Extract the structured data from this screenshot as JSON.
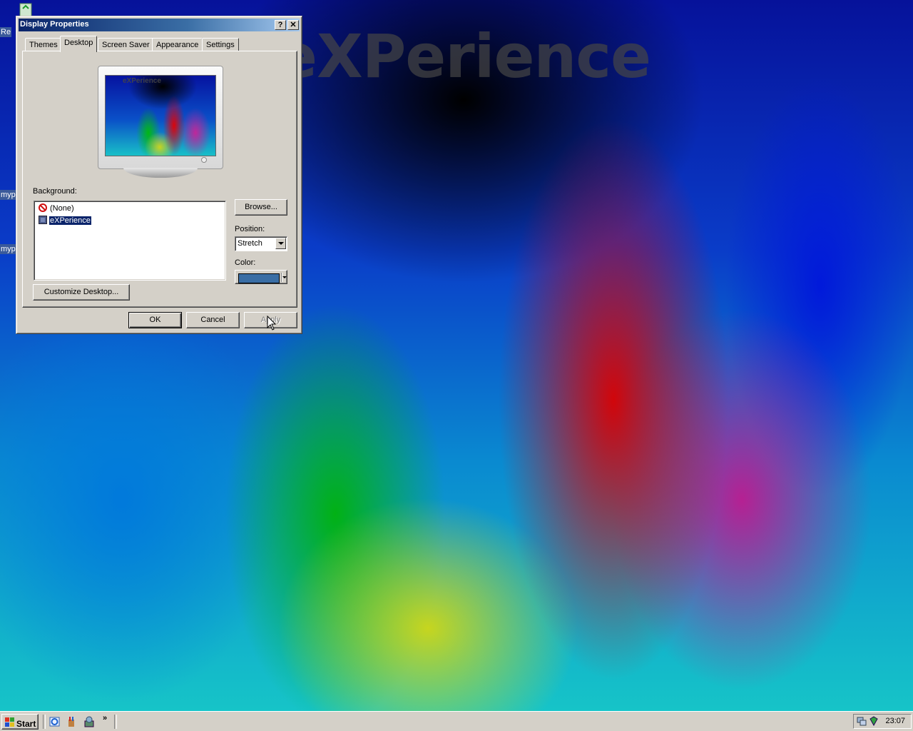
{
  "desktop": {
    "wallpaper_text": "eXPerience",
    "icons": [
      {
        "label": "Re"
      },
      {
        "label": "myp"
      },
      {
        "label": "myp"
      }
    ]
  },
  "dialog": {
    "title": "Display Properties",
    "help_button": "?",
    "close_button": "✕",
    "tabs": [
      {
        "label": "Themes",
        "active": false
      },
      {
        "label": "Desktop",
        "active": true
      },
      {
        "label": "Screen Saver",
        "active": false
      },
      {
        "label": "Appearance",
        "active": false
      },
      {
        "label": "Settings",
        "active": false
      }
    ],
    "preview": {
      "wallpaper_text": "eXPerience"
    },
    "background_label": "Background:",
    "background_items": [
      {
        "label": "(None)",
        "icon": "none-icon",
        "selected": false
      },
      {
        "label": "eXPerience",
        "icon": "image-file-icon",
        "selected": true
      }
    ],
    "browse_button": "Browse...",
    "position_label": "Position:",
    "position_value": "Stretch",
    "color_label": "Color:",
    "color_value": "#3a6ea5",
    "customize_button": "Customize Desktop...",
    "ok_button": "OK",
    "cancel_button": "Cancel",
    "apply_button": "Apply",
    "apply_enabled": false
  },
  "taskbar": {
    "start_label": "Start",
    "quick_launch": [
      "ie-icon",
      "paint-icon",
      "tool-icon"
    ],
    "chevron": "»",
    "clock": "23:07"
  },
  "colors": {
    "dialog_face": "#d4d0c8",
    "titlebar_start": "#0a246a",
    "titlebar_end": "#a6caf0",
    "selection": "#0a246a"
  }
}
